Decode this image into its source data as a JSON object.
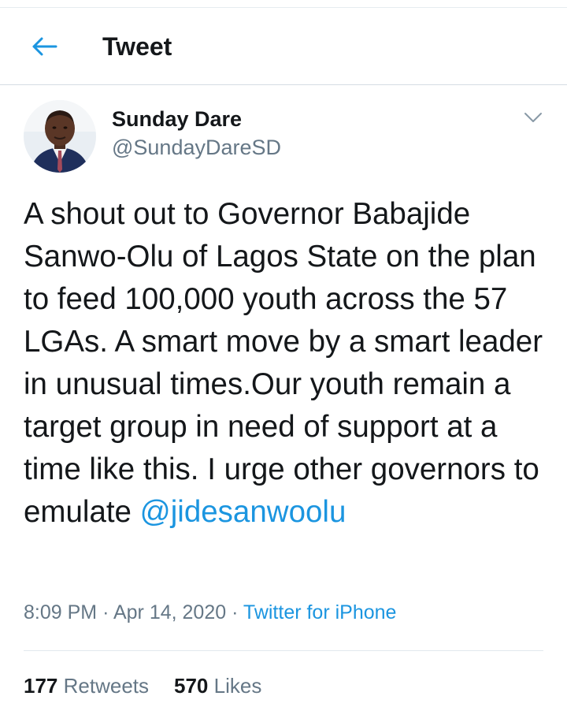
{
  "header": {
    "title": "Tweet",
    "back_icon": "arrow-left-icon"
  },
  "colors": {
    "accent": "#1b95e0",
    "text": "#14171a",
    "muted": "#657786"
  },
  "tweet": {
    "author_name": "Sunday Dare",
    "author_handle": "@SundayDareSD",
    "text": "A shout out to Governor Babajide Sanwo-Olu of Lagos State on the plan to feed 100,000 youth across the 57 LGAs. A smart move by a smart leader in unusual times.Our youth remain a target group in need of support at a time like this. I urge other governors to emulate ",
    "mention": "@jidesanwoolu",
    "time": "8:09 PM",
    "sep1": "·",
    "date": "Apr 14, 2020",
    "sep2": "·",
    "source": "Twitter for iPhone"
  },
  "stats": {
    "retweets_count": "177",
    "retweets_label": "Retweets",
    "likes_count": "570",
    "likes_label": "Likes"
  }
}
